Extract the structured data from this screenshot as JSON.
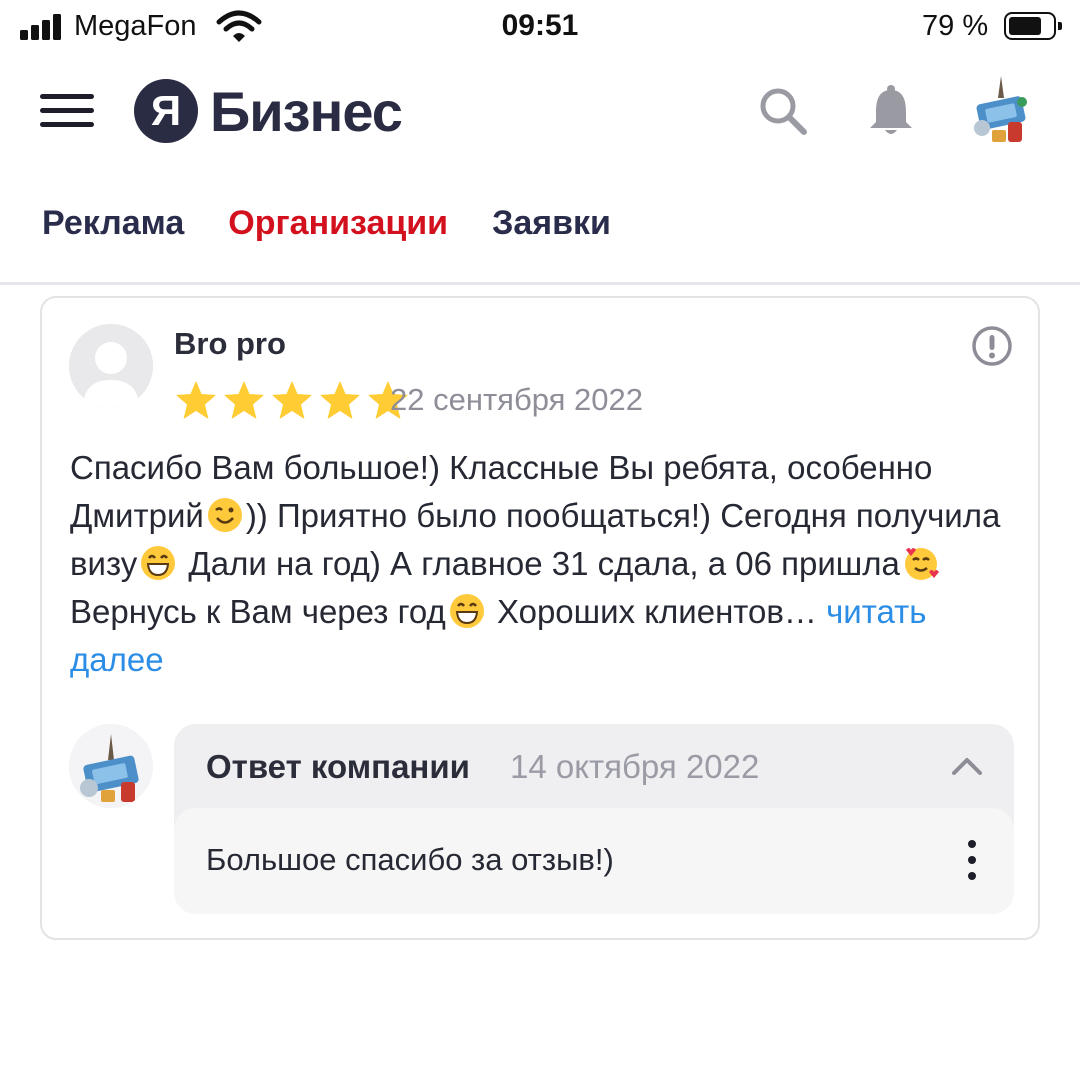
{
  "status_bar": {
    "carrier": "MegaFon",
    "time": "09:51",
    "battery_percent": "79 %",
    "battery_level": 0.79,
    "icons": [
      "signal-icon",
      "wifi-icon",
      "battery-icon"
    ]
  },
  "header": {
    "logo_mark": "Я",
    "logo_text": "Бизнес",
    "icons": [
      "menu-icon",
      "search-icon",
      "bell-icon",
      "avatar"
    ]
  },
  "tabs": [
    {
      "label": "Реклама",
      "active": false
    },
    {
      "label": "Организации",
      "active": true
    },
    {
      "label": "Заявки",
      "active": false
    }
  ],
  "review": {
    "author": "Bro pro",
    "rating": 5,
    "rating_max": 5,
    "date": "22 сентября 2022",
    "text_parts": [
      "Спасибо Вам большое!) Классные Вы ребята, особенно Дмитрий",
      ")) Приятно было пообщаться!) Сегодня получила визу",
      " Дали на год) А главное 31 сдала, а 06 пришла",
      " Вернусь к Вам через год",
      " Хороших клиентов…"
    ],
    "emojis": [
      "wink-emoji",
      "grin-emoji",
      "smiling-hearts-emoji",
      "grin-emoji"
    ],
    "read_more": "читать далее",
    "report_icon": "exclamation-circle-icon"
  },
  "company_response": {
    "title": "Ответ компании",
    "date": "14 октября 2022",
    "text": "Большое спасибо за отзыв!)",
    "icons": [
      "chevron-up-icon",
      "more-vertical-icon"
    ]
  },
  "colors": {
    "brand_dark": "#2a2c43",
    "active_tab": "#d3101d",
    "star": "#ffcc33",
    "link": "#2b8de6"
  }
}
